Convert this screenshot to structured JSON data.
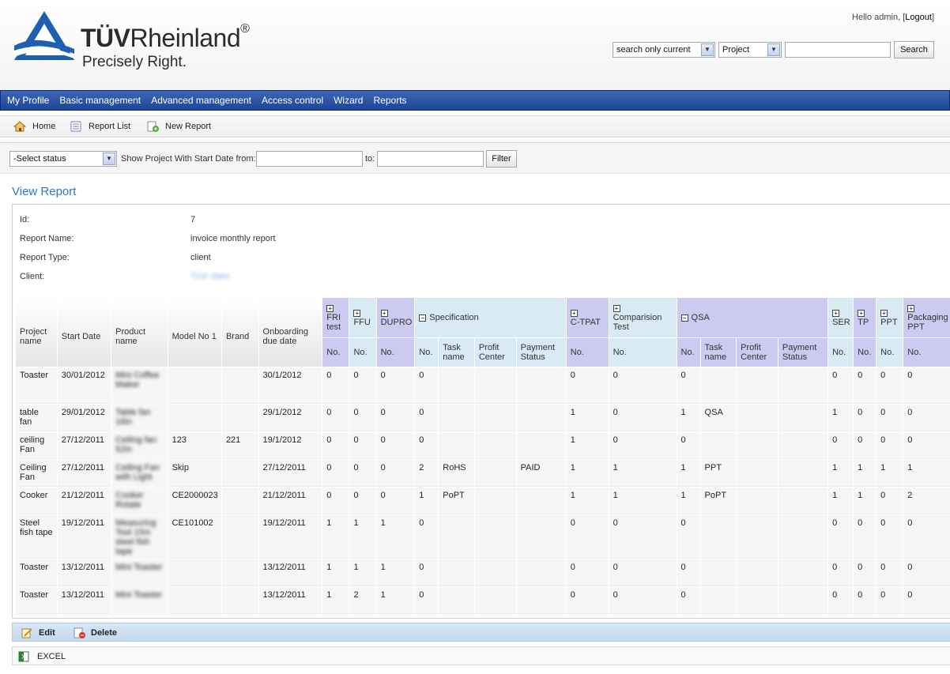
{
  "header": {
    "brand_name_bold": "TÜV",
    "brand_name_rest": "Rheinland",
    "brand_reg": "®",
    "tagline": "Precisely Right.",
    "hello_prefix": "Hello admin, [",
    "logout_label": "Logout",
    "hello_suffix": "]",
    "search_scope": "search only current",
    "search_type": "Project",
    "search_value": "",
    "search_button": "Search"
  },
  "nav": {
    "items": [
      "My Profile",
      "Basic management",
      "Advanced management",
      "Access control",
      "Wizard",
      "Reports"
    ]
  },
  "toolbar": {
    "home": "Home",
    "report_list": "Report List",
    "new_report": "New Report"
  },
  "filter": {
    "status": "-Select status",
    "from_label": "Show Project With Start Date from:",
    "to_label": "to:",
    "from_value": "",
    "to_value": "",
    "filter_button": "Filter"
  },
  "view_title": "View Report",
  "report": {
    "id_label": "Id:",
    "id": "7",
    "name_label": "Report Name:",
    "name": "invoice monthly report",
    "type_label": "Report Type:",
    "type": "client",
    "client_label": "Client:",
    "client": "TÜV rhein"
  },
  "table": {
    "main_headers": [
      "Project name",
      "Start Date",
      "Product name",
      "Model No 1",
      "Brand",
      "Onboarding due date"
    ],
    "groups": [
      {
        "label": "FRI test",
        "toggle": "+",
        "color": "lav"
      },
      {
        "label": "FFU",
        "toggle": "+",
        "color": "blue"
      },
      {
        "label": "DUPRO",
        "toggle": "+",
        "color": "lav"
      },
      {
        "label": "Specification",
        "toggle": "−",
        "color": "blue"
      },
      {
        "label": "C-TPAT",
        "toggle": "+",
        "color": "lav"
      },
      {
        "label": "Comparision Test",
        "toggle": "+",
        "color": "blue"
      },
      {
        "label": "QSA",
        "toggle": "−",
        "color": "lav"
      },
      {
        "label": "SER",
        "toggle": "+",
        "color": "blue"
      },
      {
        "label": "TP",
        "toggle": "+",
        "color": "lav"
      },
      {
        "label": "PPT",
        "toggle": "+",
        "color": "blue"
      },
      {
        "label": "Packaging PPT",
        "toggle": "+",
        "color": "lav"
      }
    ],
    "sub_headers": [
      "No.",
      "No.",
      "No.",
      "No.",
      "Task name",
      "Profit Center",
      "Payment Status",
      "No.",
      "No.",
      "No.",
      "Task name",
      "Profit Center",
      "Payment Status",
      "No.",
      "No.",
      "No.",
      "No."
    ],
    "rows": [
      [
        "Toaster",
        "30/01/2012",
        "Mini Coffee Maker",
        "",
        "",
        "30/1/2012",
        "0",
        "0",
        "0",
        "0",
        "",
        "",
        "",
        "0",
        "0",
        "0",
        "",
        "",
        "",
        "0",
        "0",
        "0",
        "0"
      ],
      [
        "table fan",
        "29/01/2012",
        "Table fan 16in",
        "",
        "",
        "29/1/2012",
        "0",
        "0",
        "0",
        "0",
        "",
        "",
        "",
        "1",
        "0",
        "1",
        "QSA",
        "",
        "",
        "1",
        "0",
        "0",
        "0"
      ],
      [
        "ceiling Fan",
        "27/12/2011",
        "Ceiling fan 52in",
        "123",
        "221",
        "19/1/2012",
        "0",
        "0",
        "0",
        "0",
        "",
        "",
        "",
        "1",
        "0",
        "0",
        "",
        "",
        "",
        "0",
        "0",
        "0",
        "0"
      ],
      [
        "Ceiling Fan",
        "27/12/2011",
        "Ceiling Fan with Light",
        "Skip",
        "",
        "27/12/2011",
        "0",
        "0",
        "0",
        "2",
        "RoHS",
        "",
        "PAID",
        "1",
        "1",
        "1",
        "PPT",
        "",
        "",
        "1",
        "1",
        "1",
        "1"
      ],
      [
        "Cooker",
        "21/12/2011",
        "Cooker Rotate",
        "CE2000023",
        "",
        "21/12/2011",
        "0",
        "0",
        "0",
        "1",
        "PoPT",
        "",
        "",
        "1",
        "1",
        "1",
        "PoPT",
        "",
        "",
        "1",
        "1",
        "0",
        "2"
      ],
      [
        "Steel fish tape",
        "19/12/2011",
        "Measuring Tool 15m steel fish tape",
        "CE101002",
        "",
        "19/12/2011",
        "1",
        "1",
        "1",
        "0",
        "",
        "",
        "",
        "0",
        "0",
        "0",
        "",
        "",
        "",
        "0",
        "0",
        "0",
        "0"
      ],
      [
        "Toaster",
        "13/12/2011",
        "Mini Toaster",
        "",
        "",
        "13/12/2011",
        "1",
        "1",
        "1",
        "0",
        "",
        "",
        "",
        "0",
        "0",
        "0",
        "",
        "",
        "",
        "0",
        "0",
        "0",
        "0"
      ],
      [
        "Toaster",
        "13/12/2011",
        "Mini Toaster",
        "",
        "",
        "13/12/2011",
        "1",
        "2",
        "1",
        "0",
        "",
        "",
        "",
        "0",
        "0",
        "0",
        "",
        "",
        "",
        "0",
        "0",
        "0",
        "0"
      ]
    ]
  },
  "actions": {
    "edit": "Edit",
    "delete": "Delete",
    "excel": "EXCEL"
  },
  "colors": {
    "nav_blue": "#1d4598",
    "title_blue": "#2b79c2",
    "group_lavender": "#cccaf0",
    "group_blue": "#d8ebf5",
    "logo_blue": "#1f5fae"
  }
}
